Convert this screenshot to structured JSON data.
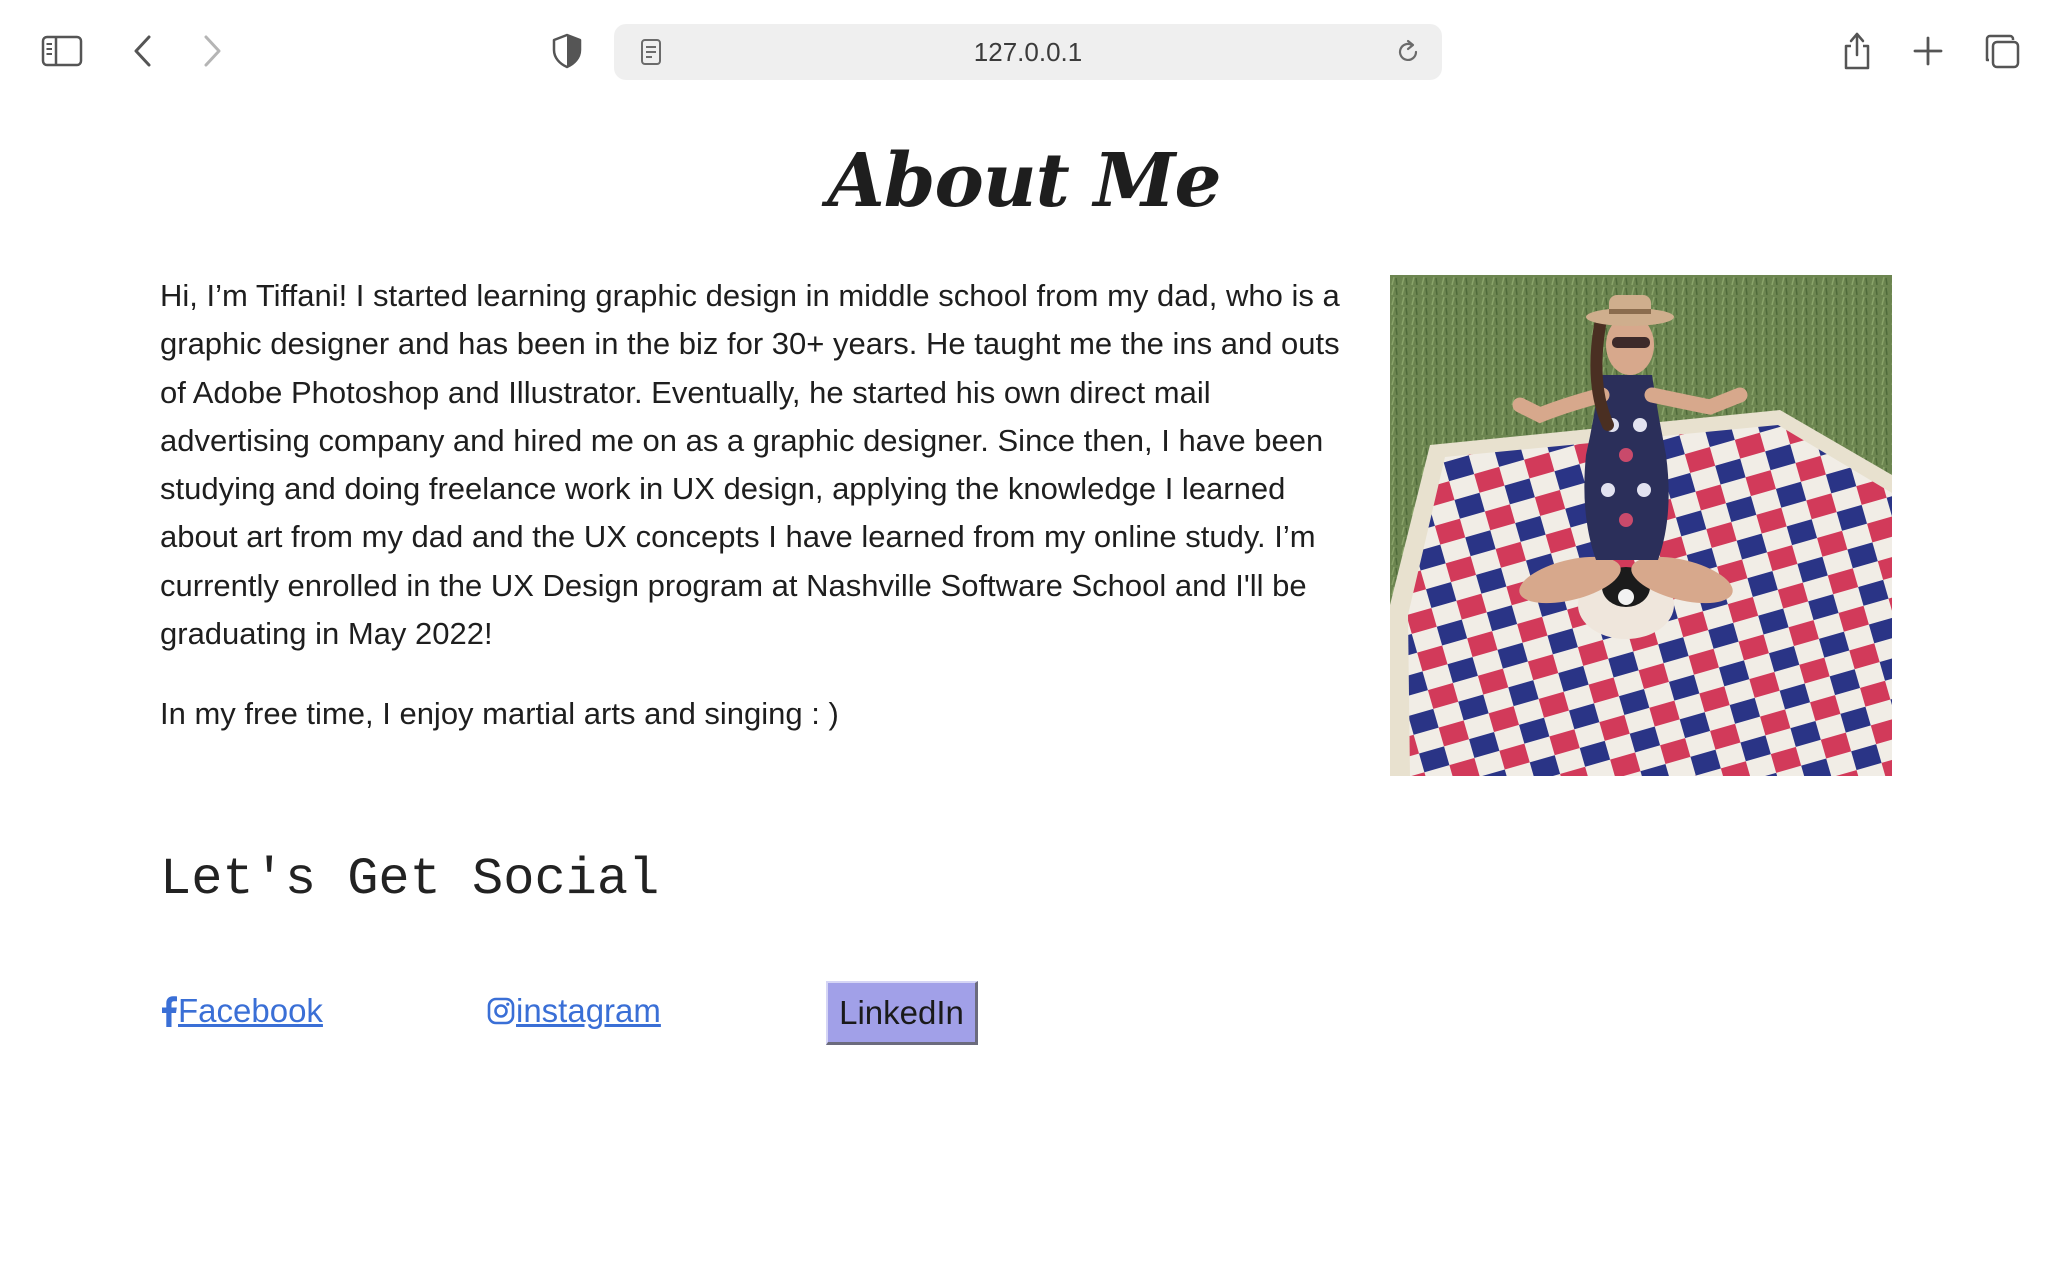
{
  "browser": {
    "url": "127.0.0.1",
    "icons": {
      "sidebar": "sidebar-icon",
      "back": "chevron-left-icon",
      "forward": "chevron-right-icon",
      "privacy": "shield-icon",
      "page": "page-icon",
      "reload": "reload-icon",
      "share": "share-icon",
      "new_tab": "plus-icon",
      "tabs": "tabs-overview-icon"
    }
  },
  "page": {
    "title": "About Me",
    "bio_paragraph_1": "Hi, I’m Tiffani! I started learning graphic design in middle school from my dad, who is a graphic designer and has been in the biz for 30+ years. He taught me the ins and outs of Adobe Photoshop and Illustrator. Eventually, he started his own direct mail advertising company and hired me on as a graphic designer. Since then, I have been studying and doing freelance work in UX design, applying the knowledge I learned about art from my dad and the UX concepts I have learned from my online study. I’m currently enrolled in the UX Design program at Nashville Software School and I'll be graduating in May 2022!",
    "bio_paragraph_2": "In my free time, I enjoy martial arts and singing : )",
    "photo_alt": "photo of Tiffani sitting on a checkered picnic blanket with a small dog",
    "social": {
      "heading": "Let's Get Social",
      "facebook_label": "Facebook",
      "instagram_label": "instagram",
      "linkedin_label": "LinkedIn"
    }
  },
  "colors": {
    "link": "#3a6fd6",
    "linkedin_button": "#a1a0e8",
    "text": "#1e1e1e"
  }
}
